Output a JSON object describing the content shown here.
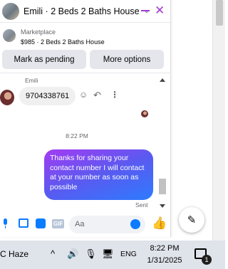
{
  "chat": {
    "title": "Emili · 2 Beds 2 Baths House",
    "marketplace_label": "Marketplace",
    "listing": "$985 · 2 Beds 2 Baths House",
    "mark_pending_label": "Mark as pending",
    "more_options_label": "More options"
  },
  "messages": {
    "sender_name": "Emili",
    "incoming_text": "9704338761",
    "time_separator": "8:22 PM",
    "outgoing_text": "Thanks for sharing your contact number I will contact at your number as soon as possible",
    "status": "Sent"
  },
  "composer": {
    "gif_label": "GIF",
    "placeholder": "Aa"
  },
  "taskbar": {
    "weather": "C  Haze",
    "language": "ENG",
    "time": "8:22 PM",
    "date": "1/31/2025",
    "notification_count": "1"
  },
  "colors": {
    "accent": "#a33bd6",
    "messenger_blue": "#0a7cff",
    "bubble_gradient_start": "#a33bf2",
    "bubble_gradient_end": "#2d7bff"
  },
  "icons": {
    "minimize": "minimize-icon",
    "close": "close-icon",
    "like": "thumbs-up-icon",
    "compose": "compose-icon"
  }
}
